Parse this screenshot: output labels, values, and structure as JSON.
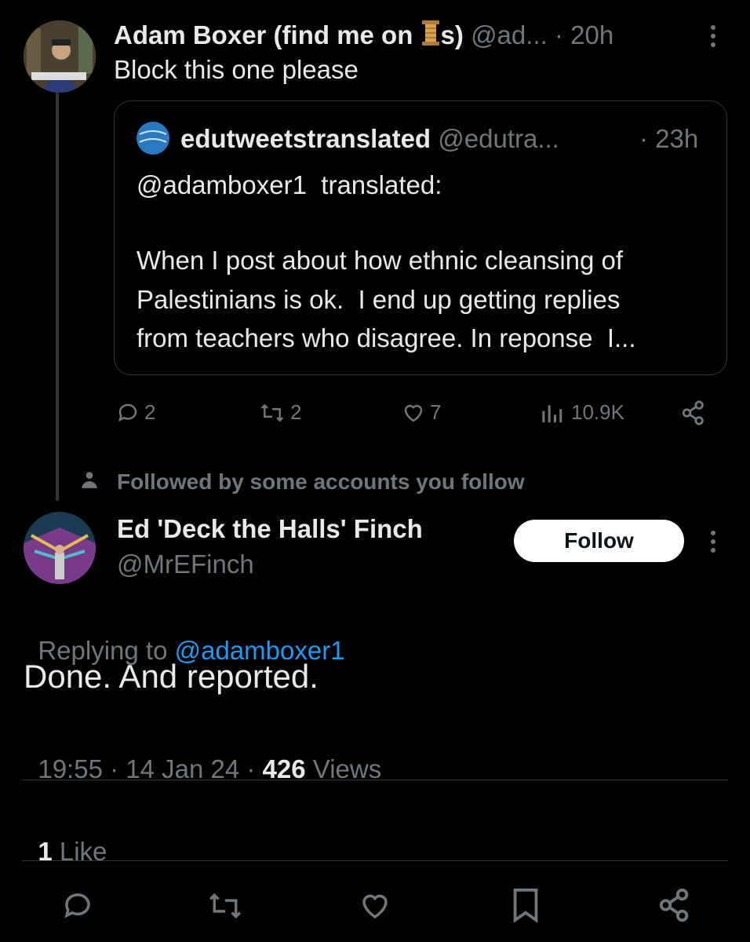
{
  "parent_tweet": {
    "author_name": "Adam Boxer (find me on ",
    "author_name_suffix": "s)",
    "handle": "@ad...",
    "time": "· 20h",
    "text": "Block this one please"
  },
  "quoted_tweet": {
    "author_name": "edutweetstranslated",
    "handle": "@edutra...",
    "time": "· 23h",
    "line1": "@adamboxer1  translated:",
    "line2": "When I post about how ethnic cleansing of",
    "line3": "Palestinians is ok.  I end up getting replies",
    "line4": "from teachers who disagree. In reponse  I..."
  },
  "parent_actions": {
    "replies": "2",
    "reposts": "2",
    "likes": "7",
    "views": "10.9K"
  },
  "social_context": "Followed by some accounts you follow",
  "reply_tweet": {
    "author_name": "Ed 'Deck the Halls' Finch",
    "handle": "@MrEFinch",
    "follow_label": "Follow",
    "replying_prefix": "Replying to ",
    "replying_to": "@adamboxer1",
    "text": "Done. And reported.",
    "timestamp": "19:55 · 14 Jan 24 · ",
    "views_count": "426",
    "views_label": " Views"
  },
  "likes_summary": {
    "count": "1",
    "label": " Like"
  },
  "colors": {
    "background": "#000000",
    "text": "#e7e9ea",
    "muted": "#71767b",
    "link": "#1d9bf0",
    "border": "#2f3336"
  }
}
